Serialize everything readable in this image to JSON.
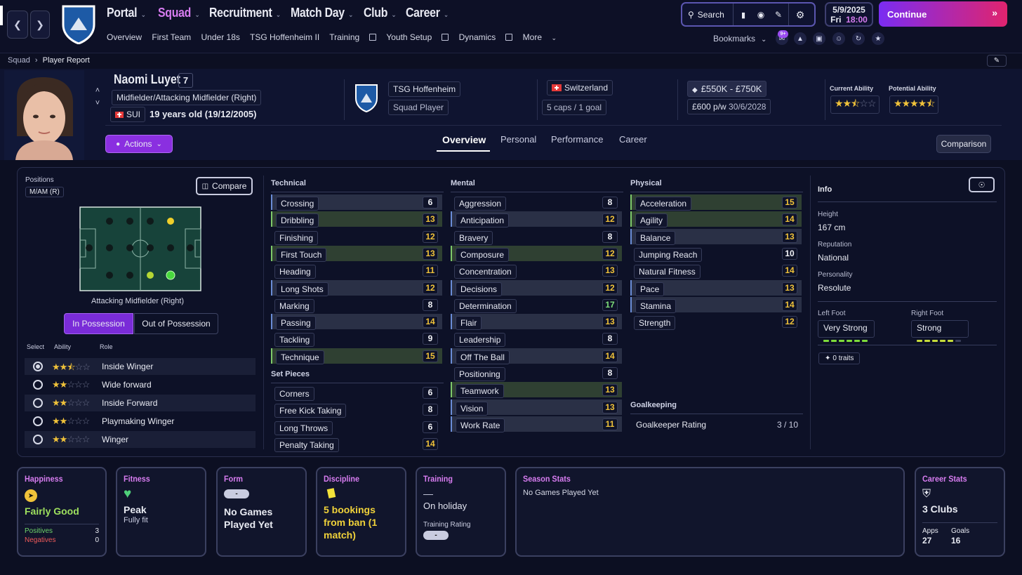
{
  "nav": {
    "items": [
      {
        "label": "Portal"
      },
      {
        "label": "Squad"
      },
      {
        "label": "Recruitment"
      },
      {
        "label": "Match Day"
      },
      {
        "label": "Club"
      },
      {
        "label": "Career"
      }
    ],
    "sub": [
      "Overview",
      "First Team",
      "Under 18s",
      "TSG Hoffenheim II",
      "Training",
      "Youth Setup",
      "Dynamics",
      "More"
    ],
    "search_label": "Search",
    "bookmarks_label": "Bookmarks",
    "notif_badge": "9+",
    "date": "5/9/2025",
    "day": "Fri",
    "time": "18:00",
    "continue_label": "Continue",
    "accent": "#d77cf0"
  },
  "breadcrumb": {
    "parent": "Squad",
    "current": "Player Report"
  },
  "player": {
    "name": "Naomi Luyet",
    "number": "7",
    "position": "Midfielder/Attacking Midfielder (Right)",
    "nation_code": "SUI",
    "age": "19 years old (19/12/2005)",
    "club": "TSG Hoffenheim",
    "squad_status": "Squad Player",
    "nationality": "Switzerland",
    "caps": "5 caps / 1 goal",
    "value": "£550K - £750K",
    "wage": "£600 p/w",
    "contract": "30/6/2028",
    "current_ability_label": "Current Ability",
    "potential_ability_label": "Potential Ability",
    "current_ability_stars": 2.5,
    "potential_ability_stars": 4.5,
    "actions_label": "Actions",
    "comparison_label": "Comparison"
  },
  "tabs": [
    "Overview",
    "Personal",
    "Performance",
    "Career"
  ],
  "positions": {
    "label": "Positions",
    "code": "M/AM (R)",
    "compare_label": "Compare",
    "pitch_caption": "Attacking Midfielder (Right)",
    "in_possession": "In Possession",
    "out_possession": "Out of Possession",
    "hdr_select": "Select",
    "hdr_ability": "Ability",
    "hdr_role": "Role",
    "roles": [
      {
        "name": "Inside Winger",
        "stars": 2.5,
        "selected": true
      },
      {
        "name": "Wide forward",
        "stars": 2,
        "selected": false
      },
      {
        "name": "Inside Forward",
        "stars": 2,
        "selected": false
      },
      {
        "name": "Playmaking Winger",
        "stars": 2,
        "selected": false
      },
      {
        "name": "Winger",
        "stars": 2,
        "selected": false
      }
    ]
  },
  "technical": {
    "label": "Technical",
    "attrs": [
      {
        "name": "Crossing",
        "value": 6,
        "hl": "blu"
      },
      {
        "name": "Dribbling",
        "value": 13,
        "hl": "grn"
      },
      {
        "name": "Finishing",
        "value": 12,
        "hl": ""
      },
      {
        "name": "First Touch",
        "value": 13,
        "hl": "grn"
      },
      {
        "name": "Heading",
        "value": 11,
        "hl": ""
      },
      {
        "name": "Long Shots",
        "value": 12,
        "hl": "blu"
      },
      {
        "name": "Marking",
        "value": 8,
        "hl": ""
      },
      {
        "name": "Passing",
        "value": 14,
        "hl": "blu"
      },
      {
        "name": "Tackling",
        "value": 9,
        "hl": ""
      },
      {
        "name": "Technique",
        "value": 15,
        "hl": "grn"
      }
    ]
  },
  "set_pieces": {
    "label": "Set Pieces",
    "attrs": [
      {
        "name": "Corners",
        "value": 6,
        "hl": ""
      },
      {
        "name": "Free Kick Taking",
        "value": 8,
        "hl": ""
      },
      {
        "name": "Long Throws",
        "value": 6,
        "hl": ""
      },
      {
        "name": "Penalty Taking",
        "value": 14,
        "hl": ""
      }
    ]
  },
  "mental": {
    "label": "Mental",
    "attrs": [
      {
        "name": "Aggression",
        "value": 8,
        "hl": ""
      },
      {
        "name": "Anticipation",
        "value": 12,
        "hl": "blu"
      },
      {
        "name": "Bravery",
        "value": 8,
        "hl": ""
      },
      {
        "name": "Composure",
        "value": 12,
        "hl": "grn"
      },
      {
        "name": "Concentration",
        "value": 13,
        "hl": ""
      },
      {
        "name": "Decisions",
        "value": 12,
        "hl": "blu"
      },
      {
        "name": "Determination",
        "value": 17,
        "hl": ""
      },
      {
        "name": "Flair",
        "value": 13,
        "hl": "blu"
      },
      {
        "name": "Leadership",
        "value": 8,
        "hl": ""
      },
      {
        "name": "Off The Ball",
        "value": 14,
        "hl": "blu"
      },
      {
        "name": "Positioning",
        "value": 8,
        "hl": ""
      },
      {
        "name": "Teamwork",
        "value": 13,
        "hl": "grn"
      },
      {
        "name": "Vision",
        "value": 13,
        "hl": "blu"
      },
      {
        "name": "Work Rate",
        "value": 11,
        "hl": "blu"
      }
    ]
  },
  "physical": {
    "label": "Physical",
    "attrs": [
      {
        "name": "Acceleration",
        "value": 15,
        "hl": "grn"
      },
      {
        "name": "Agility",
        "value": 14,
        "hl": "grn"
      },
      {
        "name": "Balance",
        "value": 13,
        "hl": "blu"
      },
      {
        "name": "Jumping Reach",
        "value": 10,
        "hl": ""
      },
      {
        "name": "Natural Fitness",
        "value": 14,
        "hl": ""
      },
      {
        "name": "Pace",
        "value": 13,
        "hl": "blu"
      },
      {
        "name": "Stamina",
        "value": 14,
        "hl": "blu"
      },
      {
        "name": "Strength",
        "value": 12,
        "hl": ""
      }
    ]
  },
  "goalkeeping": {
    "label": "Goalkeeping",
    "rating_label": "Goalkeeper Rating",
    "rating": "3 / 10"
  },
  "info": {
    "label": "Info",
    "height_label": "Height",
    "height": "167 cm",
    "reputation_label": "Reputation",
    "reputation": "National",
    "personality_label": "Personality",
    "personality": "Resolute",
    "left_foot_label": "Left Foot",
    "left_foot": "Very Strong",
    "left_foot_level": 6,
    "right_foot_label": "Right Foot",
    "right_foot": "Strong",
    "right_foot_level": 5,
    "traits": "0 traits"
  },
  "cards": {
    "happiness": {
      "title": "Happiness",
      "value": "Fairly Good",
      "positives_label": "Positives",
      "positives": "3",
      "negatives_label": "Negatives",
      "negatives": "0"
    },
    "fitness": {
      "title": "Fitness",
      "value": "Peak",
      "sub": "Fully fit"
    },
    "form": {
      "title": "Form",
      "badge": "-",
      "value": "No Games Played Yet"
    },
    "discipline": {
      "title": "Discipline",
      "value": "5 bookings from ban (1 match)"
    },
    "training": {
      "title": "Training",
      "dash": "—",
      "value": "On holiday",
      "rating_label": "Training Rating",
      "rating": "-"
    },
    "season": {
      "title": "Season Stats",
      "value": "No Games Played Yet"
    },
    "career": {
      "title": "Career Stats",
      "value": "3 Clubs",
      "apps_label": "Apps",
      "apps": "27",
      "goals_label": "Goals",
      "goals": "16"
    }
  }
}
